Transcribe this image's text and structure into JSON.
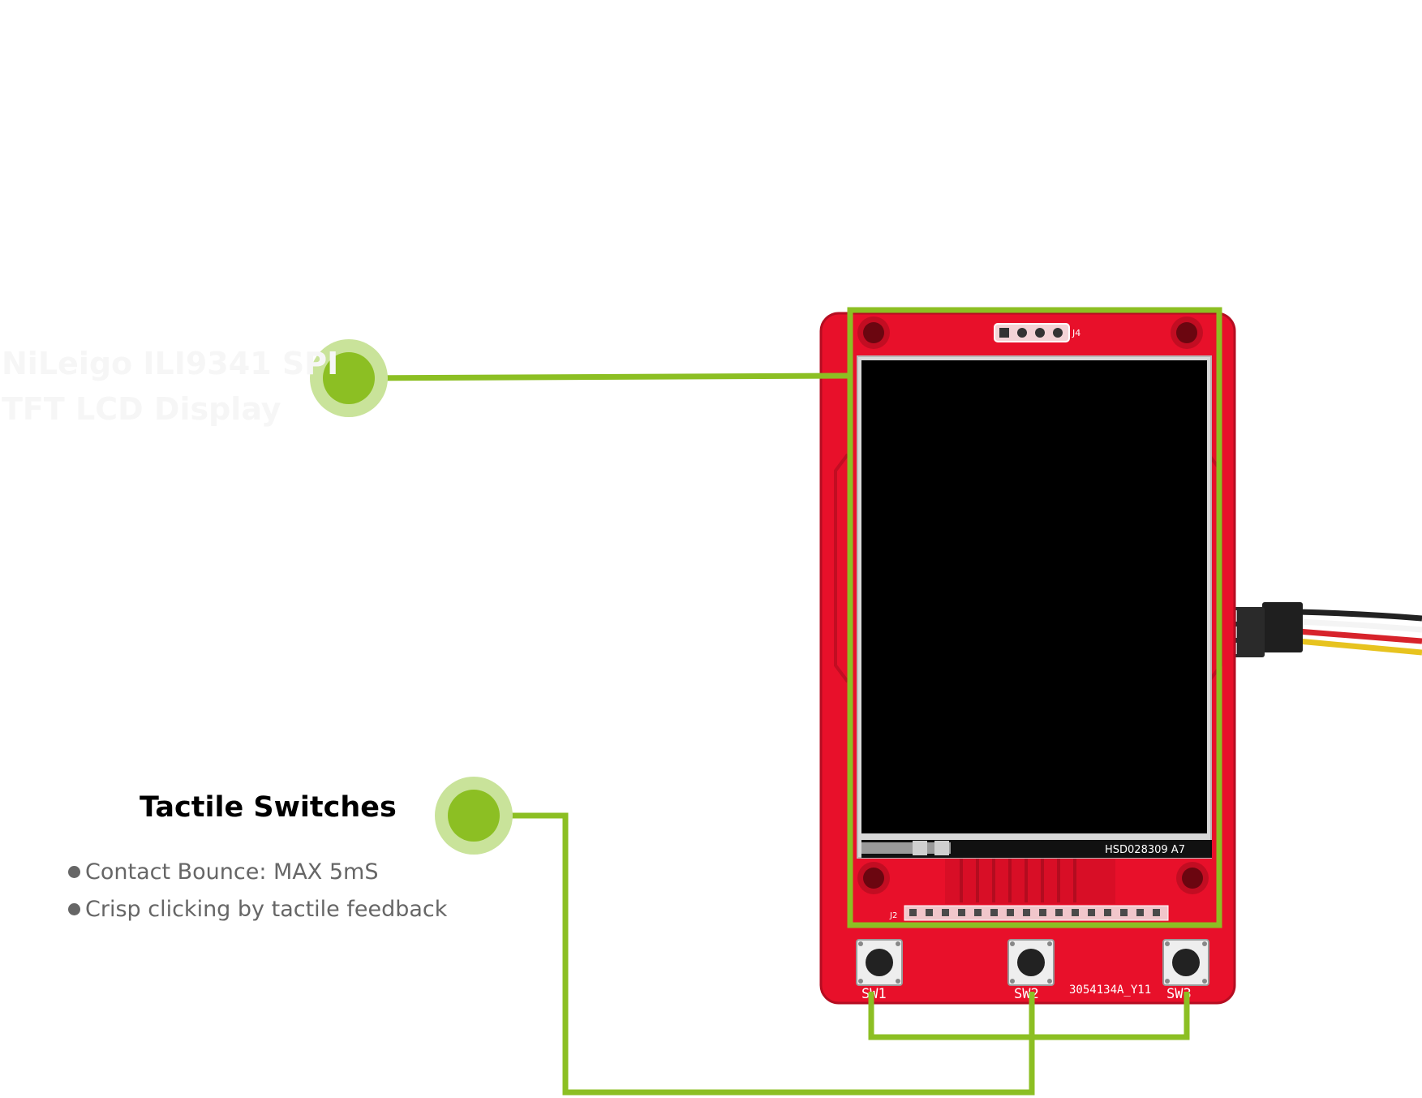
{
  "colors": {
    "accent": "#8cbf23",
    "accent_light": "#c9e39a",
    "pcb": "#e8102a",
    "screen": "#000000",
    "bullet_text": "#666666"
  },
  "callouts": {
    "display": {
      "title_line1": "NiLeigo ILI9341 SPI",
      "title_line2": "TFT LCD Display"
    },
    "switches": {
      "title": "Tactile Switches",
      "bullets": [
        "Contact Bounce: MAX 5mS",
        "Crisp clicking by tactile feedback"
      ]
    }
  },
  "board": {
    "header_label": "J4",
    "panel_label": "HSD028309  A7",
    "pin_label": "J2",
    "switch_labels": [
      "SW1",
      "SW2",
      "SW3"
    ],
    "part_number": "3054134A_Y11"
  }
}
